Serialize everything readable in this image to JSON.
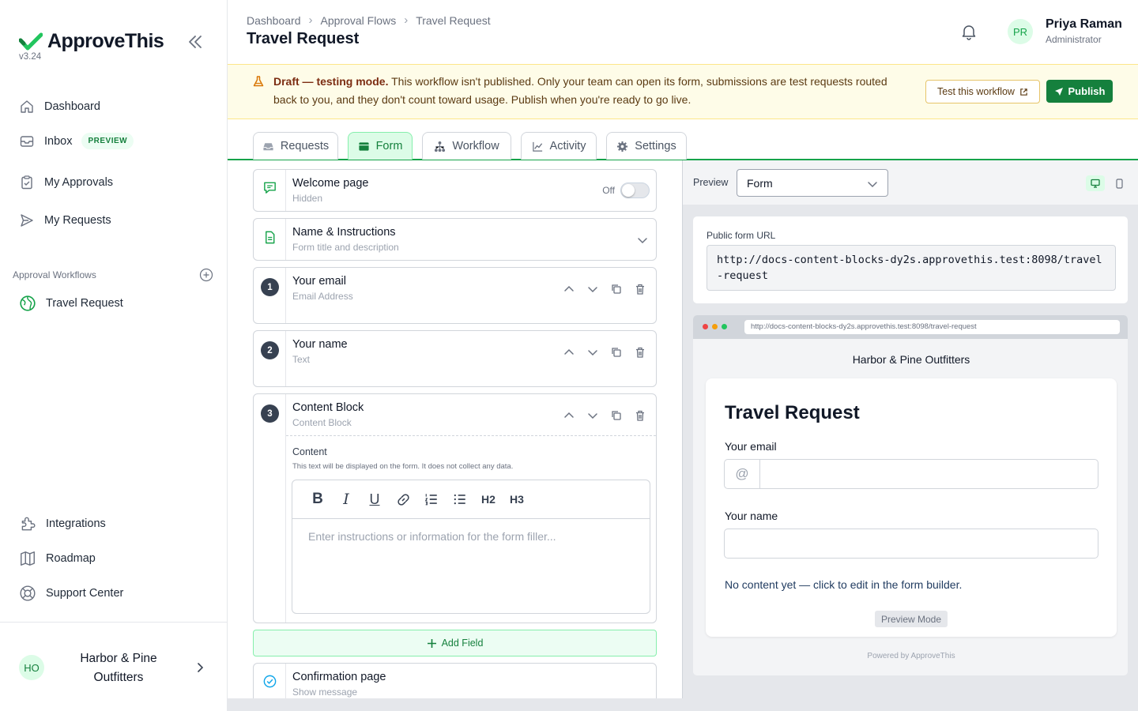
{
  "app": {
    "name": "ApproveThis",
    "version": "v3.24",
    "brand_color": "#16a34a"
  },
  "sidebar": {
    "nav": [
      {
        "label": "Dashboard",
        "icon": "home-icon"
      },
      {
        "label": "Inbox",
        "icon": "inbox-icon",
        "badge": "PREVIEW"
      },
      {
        "label": "My Approvals",
        "icon": "clipboard-check-icon"
      },
      {
        "label": "My Requests",
        "icon": "send-icon"
      }
    ],
    "section_label": "Approval Workflows",
    "workflows": [
      {
        "label": "Travel Request",
        "icon": "globe-icon"
      }
    ],
    "bottom_nav": [
      {
        "label": "Integrations",
        "icon": "puzzle-icon"
      },
      {
        "label": "Roadmap",
        "icon": "map-icon"
      },
      {
        "label": "Support Center",
        "icon": "lifebuoy-icon"
      }
    ],
    "org": {
      "initials": "HO",
      "name": "Harbor & Pine Outfitters"
    }
  },
  "header": {
    "breadcrumb": [
      "Dashboard",
      "Approval Flows",
      "Travel Request"
    ],
    "title": "Travel Request",
    "user": {
      "initials": "PR",
      "name": "Priya Raman",
      "role": "Administrator"
    }
  },
  "banner": {
    "strong": "Draft — testing mode.",
    "text": " This workflow isn't published. Only your team can open its form, submissions are test requests routed back to you, and they don't count toward usage. Publish when you're ready to go live.",
    "test_button": "Test this workflow",
    "publish_button": "Publish"
  },
  "tabs": [
    {
      "label": "Requests",
      "icon": "inbox-tray-icon",
      "active": false
    },
    {
      "label": "Form",
      "icon": "form-icon",
      "active": true
    },
    {
      "label": "Workflow",
      "icon": "workflow-icon",
      "active": false
    },
    {
      "label": "Activity",
      "icon": "chart-line-icon",
      "active": false
    },
    {
      "label": "Settings",
      "icon": "gear-icon",
      "active": false
    }
  ],
  "builder": {
    "welcome": {
      "title": "Welcome page",
      "sub": "Hidden",
      "toggle_label": "Off",
      "enabled": false
    },
    "instructions": {
      "title": "Name & Instructions",
      "sub": "Form title and description"
    },
    "fields": [
      {
        "number": "1",
        "title": "Your email",
        "type": "Email Address"
      },
      {
        "number": "2",
        "title": "Your name",
        "type": "Text"
      },
      {
        "number": "3",
        "title": "Content Block",
        "type": "Content Block"
      }
    ],
    "content_block": {
      "label": "Content",
      "help": "This text will be displayed on the form. It does not collect any data.",
      "toolbar": [
        "B",
        "I",
        "U",
        "link",
        "ordered-list",
        "bullet-list",
        "H2",
        "H3"
      ],
      "placeholder": "Enter instructions or information for the form filler..."
    },
    "add_field": "Add Field",
    "confirmation": {
      "title": "Confirmation page",
      "sub": "Show message"
    }
  },
  "preview": {
    "label": "Preview",
    "selected": "Form",
    "public_url_label": "Public form URL",
    "public_url": "http://docs-content-blocks-dy2s.approvethis.test:8098/travel-request",
    "browser_url": "http://docs-content-blocks-dy2s.approvethis.test:8098/travel-request",
    "org_name": "Harbor & Pine Outfitters",
    "form_title": "Travel Request",
    "field1_label": "Your email",
    "field1_prefix": "@",
    "field2_label": "Your name",
    "note": "No content yet — click to edit in the form builder.",
    "mode_badge": "Preview Mode",
    "powered_by": "Powered by ApproveThis"
  }
}
